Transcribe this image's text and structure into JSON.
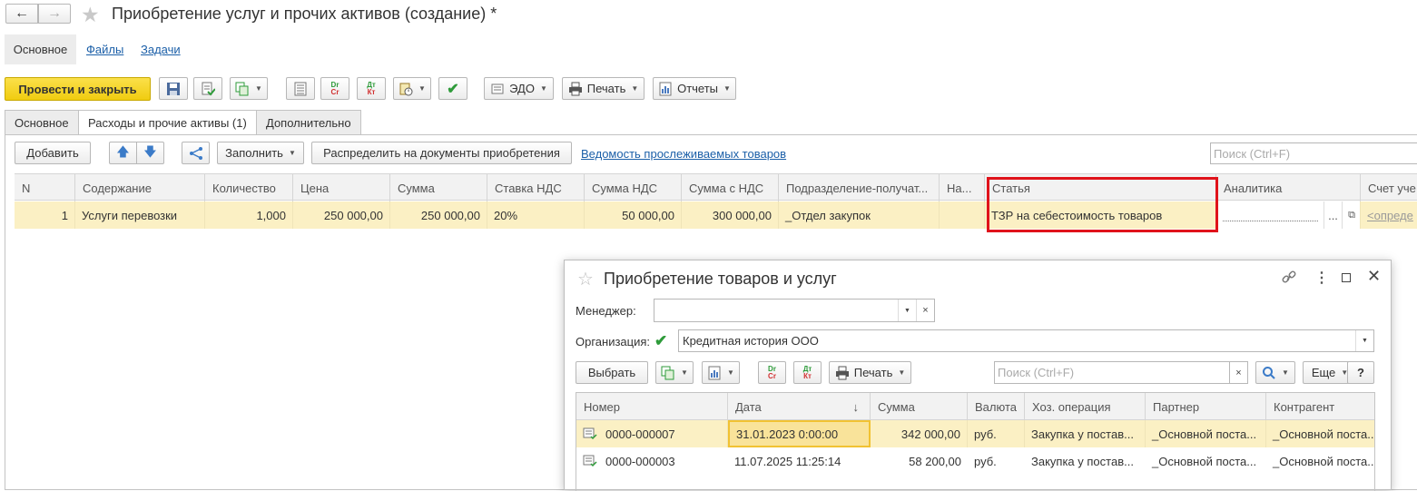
{
  "window": {
    "title": "Приобретение услуг и прочих активов (создание) *",
    "nav": {
      "back": "←",
      "forward": "→"
    }
  },
  "section_tabs": [
    "Основное",
    "Файлы",
    "Задачи"
  ],
  "toolbar": {
    "post_close": "Провести и закрыть",
    "edo": "ЭДО",
    "print": "Печать",
    "reports": "Отчеты"
  },
  "tabs": [
    "Основное",
    "Расходы и прочие активы (1)",
    "Дополнительно"
  ],
  "table_toolbar": {
    "add": "Добавить",
    "fill": "Заполнить",
    "distribute": "Распределить на документы приобретения",
    "traced_link": "Ведомость прослеживаемых товаров",
    "search_placeholder": "Поиск (Ctrl+F)"
  },
  "table": {
    "columns": [
      "N",
      "Содержание",
      "Количество",
      "Цена",
      "Сумма",
      "Ставка НДС",
      "Сумма НДС",
      "Сумма с НДС",
      "Подразделение-получат...",
      "На...",
      "Статья",
      "Аналитика",
      "Счет уче"
    ],
    "rows": [
      [
        "1",
        "Услуги перевозки",
        "1,000",
        "250 000,00",
        "250 000,00",
        "20%",
        "50 000,00",
        "300 000,00",
        "_Отдел закупок",
        "",
        "ТЗР на себестоимость товаров",
        "",
        "<опреде"
      ]
    ]
  },
  "dialog": {
    "title": "Приобретение товаров и услуг",
    "manager_label": "Менеджер:",
    "manager_value": "",
    "org_label": "Организация:",
    "org_value": "Кредитная история ООО",
    "select_btn": "Выбрать",
    "print_btn": "Печать",
    "search_placeholder": "Поиск (Ctrl+F)",
    "more_btn": "Еще",
    "help_btn": "?",
    "columns": [
      "Номер",
      "Дата",
      "Сумма",
      "Валюта",
      "Хоз. операция",
      "Партнер",
      "Контрагент"
    ],
    "rows": [
      [
        "0000-000007",
        "31.01.2023 0:00:00",
        "342 000,00",
        "руб.",
        "Закупка у постав...",
        "_Основной поста...",
        "_Основной поста..."
      ],
      [
        "0000-000003",
        "11.07.2025 11:25:14",
        "58 200,00",
        "руб.",
        "Закупка у постав...",
        "_Основной поста...",
        "_Основной поста..."
      ]
    ]
  },
  "colors": {
    "accent_yellow": "#f5d41a",
    "selected_row": "#fbf0c4",
    "highlight_red": "#e0131b",
    "green": "#2e9b3a"
  }
}
